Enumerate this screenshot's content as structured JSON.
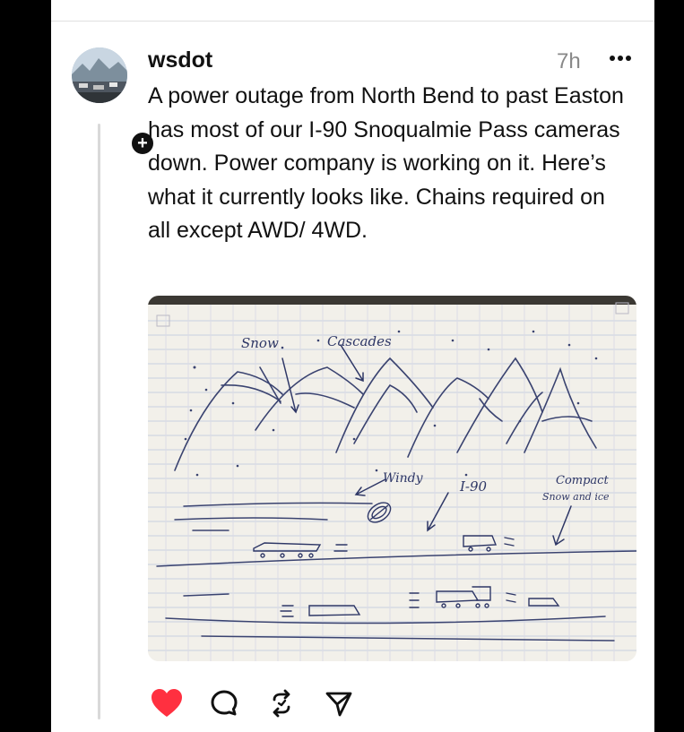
{
  "post": {
    "username": "wsdot",
    "time": "7h",
    "text": "A power outage from North Bend to past Easton has most of our I-90 Snoqualmie Pass cameras down. Power company is working on it. Here’s what it currently looks like. Chains required on all except AWD/ 4WD."
  },
  "avatar": {
    "follow_badge": "+"
  },
  "drawing": {
    "labels": {
      "snow": "Snow",
      "cascades": "Cascades",
      "windy": "Windy",
      "highway": "I-90",
      "compact": "Compact",
      "snow_and_ice": "Snow and ice"
    }
  },
  "actions": {
    "like": {
      "icon": "heart-icon",
      "state": "liked",
      "color": "#ff3040"
    },
    "reply": {
      "icon": "comment-icon"
    },
    "repost": {
      "icon": "repost-icon"
    },
    "share": {
      "icon": "share-icon"
    }
  }
}
